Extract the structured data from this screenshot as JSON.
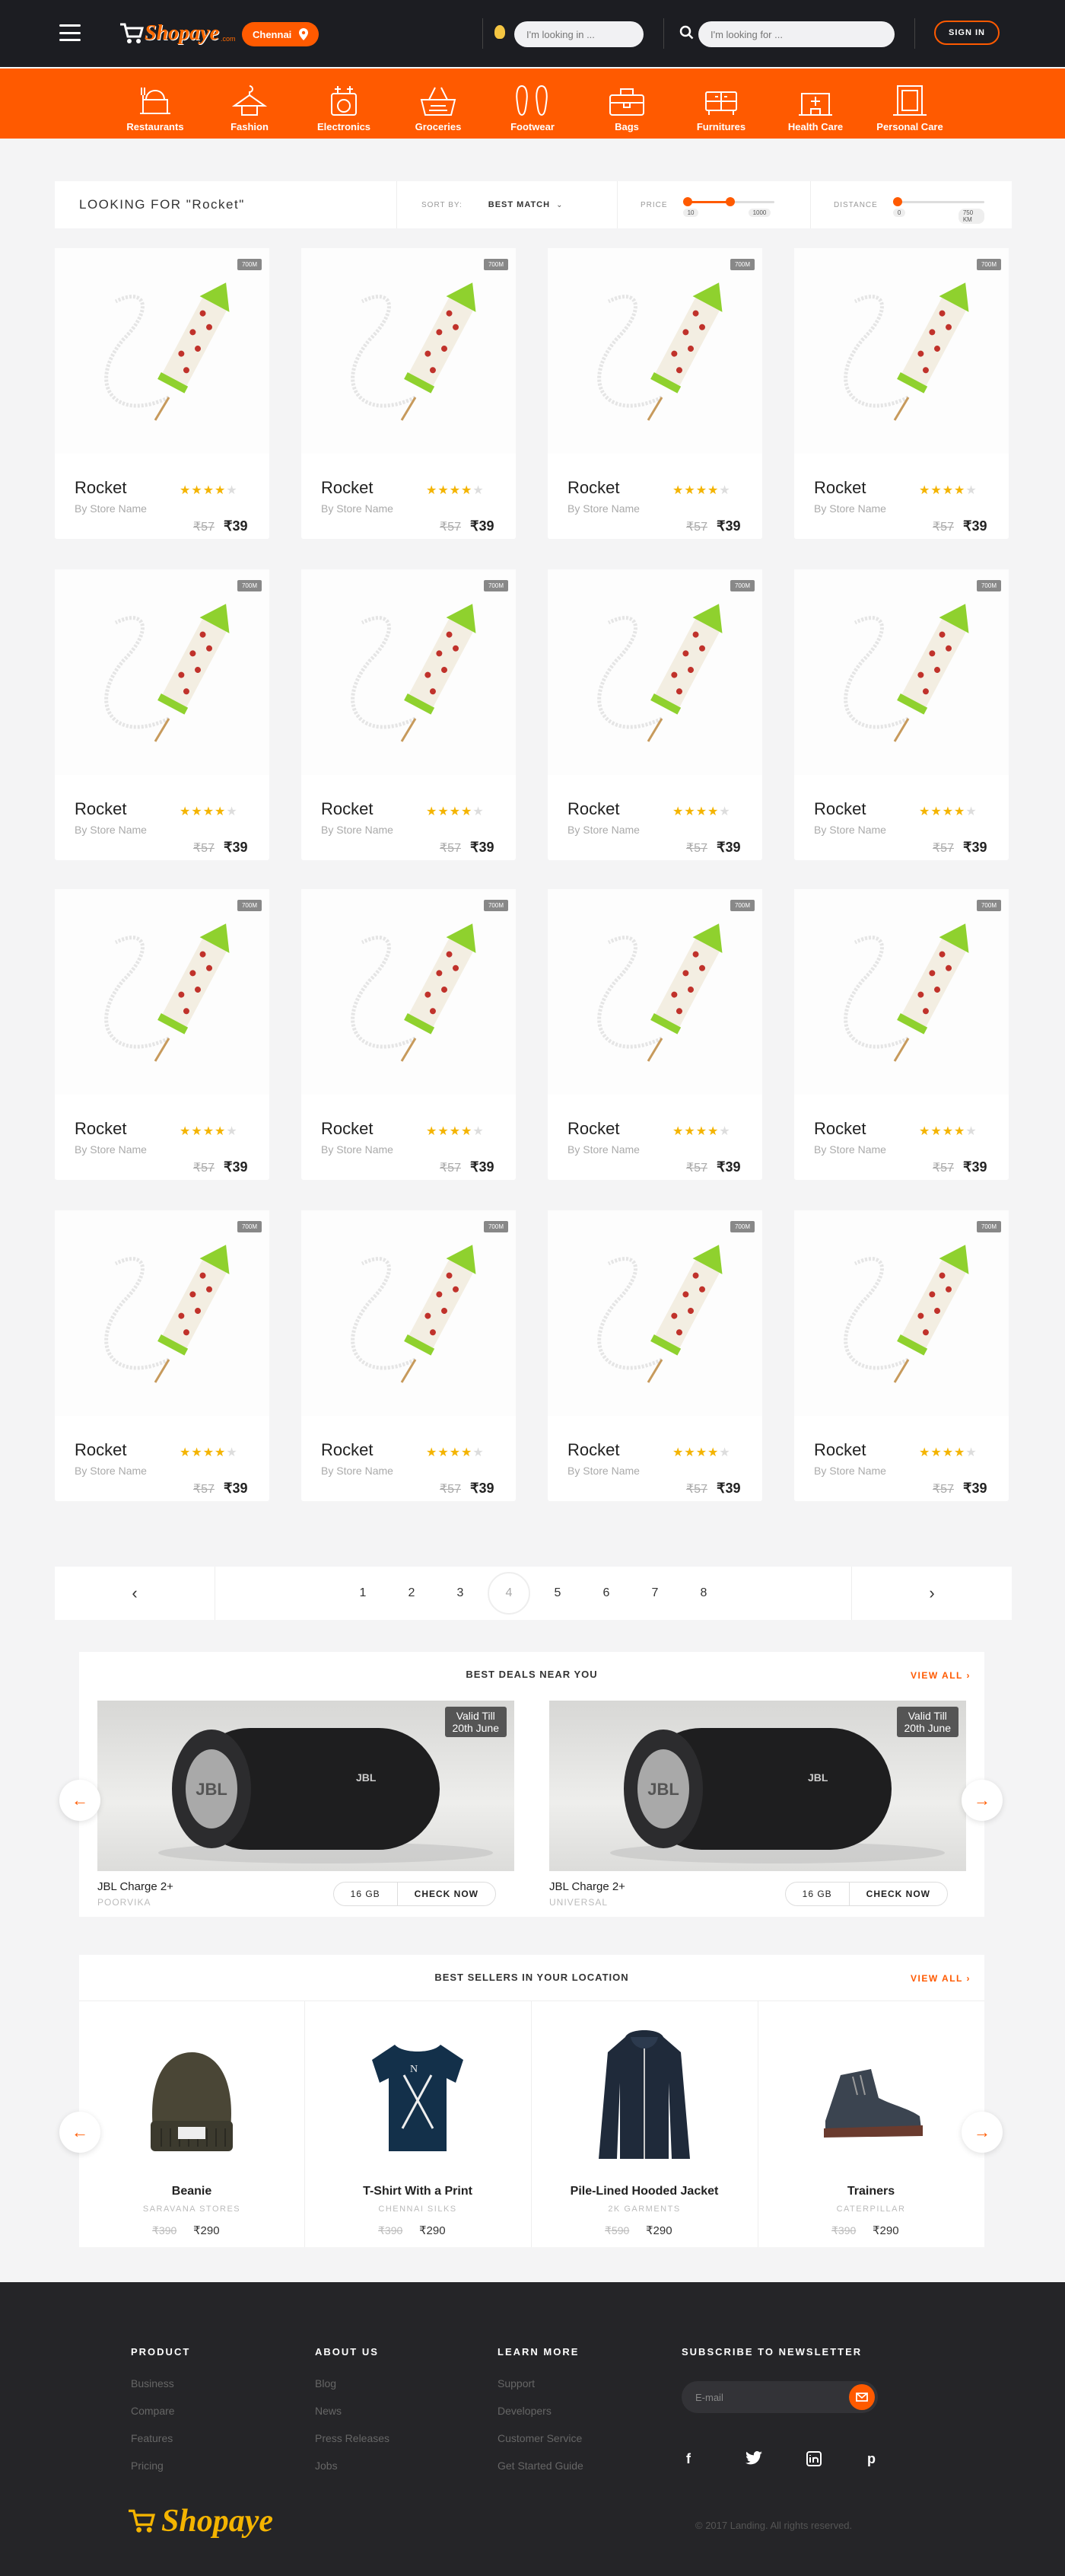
{
  "header": {
    "logo_text": "Shopaye",
    "logo_sub": ".com",
    "city": "Chennai",
    "location_placeholder": "I'm looking in ...",
    "search_placeholder": "I'm looking for ...",
    "signin_label": "SIGN IN"
  },
  "categories": [
    {
      "label": "Restaurants",
      "icon": "restaurant-icon"
    },
    {
      "label": "Fashion",
      "icon": "hanger-icon"
    },
    {
      "label": "Electronics",
      "icon": "appliance-icon"
    },
    {
      "label": "Groceries",
      "icon": "basket-icon"
    },
    {
      "label": "Footwear",
      "icon": "shoe-icon"
    },
    {
      "label": "Bags",
      "icon": "bag-icon"
    },
    {
      "label": "Furnitures",
      "icon": "furniture-icon"
    },
    {
      "label": "Health Care",
      "icon": "hospital-icon"
    },
    {
      "label": "Personal Care",
      "icon": "mirror-icon"
    }
  ],
  "filter": {
    "title": "LOOKING FOR \"Rocket\"",
    "sort_label": "SORT BY:",
    "sort_value": "BEST MATCH",
    "price_label": "PRICE",
    "price_min": "10",
    "price_max": "1000",
    "distance_label": "DISTANCE",
    "distance_min": "0",
    "distance_max": "750",
    "distance_unit": "KM"
  },
  "product": {
    "name": "Rocket",
    "store": "By Store Name",
    "old_price": "₹57",
    "new_price": "₹39",
    "distance_badge": "700M",
    "rating": 4,
    "rating_max": 5
  },
  "pagination": {
    "prev": "‹",
    "next": "›",
    "pages": [
      "1",
      "2",
      "3",
      "4",
      "5",
      "6",
      "7",
      "8"
    ],
    "active": "4"
  },
  "deals": {
    "title": "BEST DEALS NEAR YOU",
    "view_all": "VIEW ALL",
    "items": [
      {
        "name": "JBL Charge 2+",
        "store": "POORVIKA",
        "valid_line1": "Valid Till",
        "valid_line2": "20th June",
        "option": "16 GB",
        "cta": "CHECK NOW"
      },
      {
        "name": "JBL Charge 2+",
        "store": "UNIVERSAL",
        "valid_line1": "Valid Till",
        "valid_line2": "20th June",
        "option": "16 GB",
        "cta": "CHECK NOW"
      }
    ]
  },
  "sellers": {
    "title": "BEST SELLERS IN YOUR LOCATION",
    "view_all": "VIEW ALL",
    "items": [
      {
        "name": "Beanie",
        "store": "SARAVANA STORES",
        "old": "₹390",
        "new": "₹290"
      },
      {
        "name": "T-Shirt With a Print",
        "store": "CHENNAI SILKS",
        "old": "₹390",
        "new": "₹290"
      },
      {
        "name": "Pile-Lined Hooded Jacket",
        "store": "2K GARMENTS",
        "old": "₹590",
        "new": "₹290"
      },
      {
        "name": "Trainers",
        "store": "CATERPILLAR",
        "old": "₹390",
        "new": "₹290"
      }
    ]
  },
  "footer": {
    "columns": [
      {
        "title": "PRODUCT",
        "links": [
          "Business",
          "Compare",
          "Features",
          "Pricing"
        ]
      },
      {
        "title": "ABOUT US",
        "links": [
          "Blog",
          "News",
          "Press Releases",
          "Jobs"
        ]
      },
      {
        "title": "LEARN MORE",
        "links": [
          "Support",
          "Developers",
          "Customer Service",
          "Get Started Guide"
        ]
      }
    ],
    "newsletter_title": "SUBSCRIBE TO NEWSLETTER",
    "email_placeholder": "E-mail",
    "social": [
      "f",
      "t",
      "in",
      "p"
    ],
    "logo": "Shopaye",
    "copyright": "© 2017 Landing. All rights reserved."
  },
  "colors": {
    "accent": "#ff5a00",
    "header_bg": "#1c1d22",
    "footer_bg": "#252528",
    "star": "#f4b400"
  }
}
